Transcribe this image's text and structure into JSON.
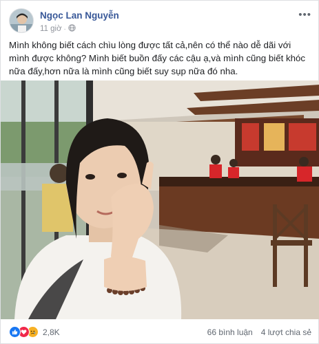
{
  "post": {
    "author": "Ngọc Lan Nguyễn",
    "time": "11 giờ",
    "privacy_icon": "globe-icon",
    "text": "Mình không biết cách chìu lòng được tất cả,nên có thể nào dễ dãi với mình được không? Mình biết buồn đấy các cậu ạ,và mình cũng biết khóc nữa đấy,hơn nữa là mình cũng biết suy sụp nữa đó nha."
  },
  "footer": {
    "reaction_icons": [
      "like-icon",
      "love-icon",
      "sad-icon"
    ],
    "reaction_count": "2,8K",
    "comments": "66 bình luận",
    "shares": "4 lượt chia sẻ"
  },
  "colors": {
    "author_link": "#385898",
    "like": "#1877f2",
    "love": "#f0284a",
    "sad": "#f7b125"
  }
}
